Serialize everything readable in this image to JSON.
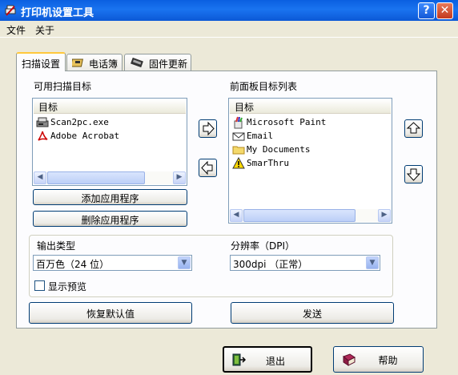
{
  "window": {
    "title": "打印机设置工具",
    "help_btn": "?",
    "close_btn": "✕"
  },
  "menu": [
    "文件",
    "关于"
  ],
  "tabs": [
    {
      "label": "扫描设置",
      "icon": "none"
    },
    {
      "label": "电话簿",
      "icon": "phonebook-icon"
    },
    {
      "label": "固件更新",
      "icon": "firmware-icon"
    }
  ],
  "left": {
    "title": "可用扫描目标",
    "header": "目标",
    "items": [
      "Scan2pc.exe",
      "Adobe Acrobat"
    ],
    "add_button": "添加应用程序",
    "remove_button": "删除应用程序"
  },
  "right": {
    "title": "前面板目标列表",
    "header": "目标",
    "items": [
      "Microsoft Paint",
      "Email",
      "My Documents",
      "SmarThru"
    ]
  },
  "output": {
    "label": "输出类型",
    "value": "百万色（24 位）"
  },
  "resolution": {
    "label": "分辨率（DPI）",
    "value": "300dpi （正常）"
  },
  "preview": {
    "label": "显示预览",
    "checked": false
  },
  "restore_button": "恢复默认值",
  "send_button": "发送",
  "exit_button": "退出",
  "help_button": "帮助",
  "icons": {
    "move_right": "arrow-right-icon",
    "move_left": "arrow-left-icon",
    "move_up": "arrow-up-icon",
    "move_down": "arrow-down-icon"
  },
  "colors": {
    "titlebar": "#0a5fe0",
    "window_bg": "#ece9d8",
    "tab_highlight": "#ffc83c"
  }
}
